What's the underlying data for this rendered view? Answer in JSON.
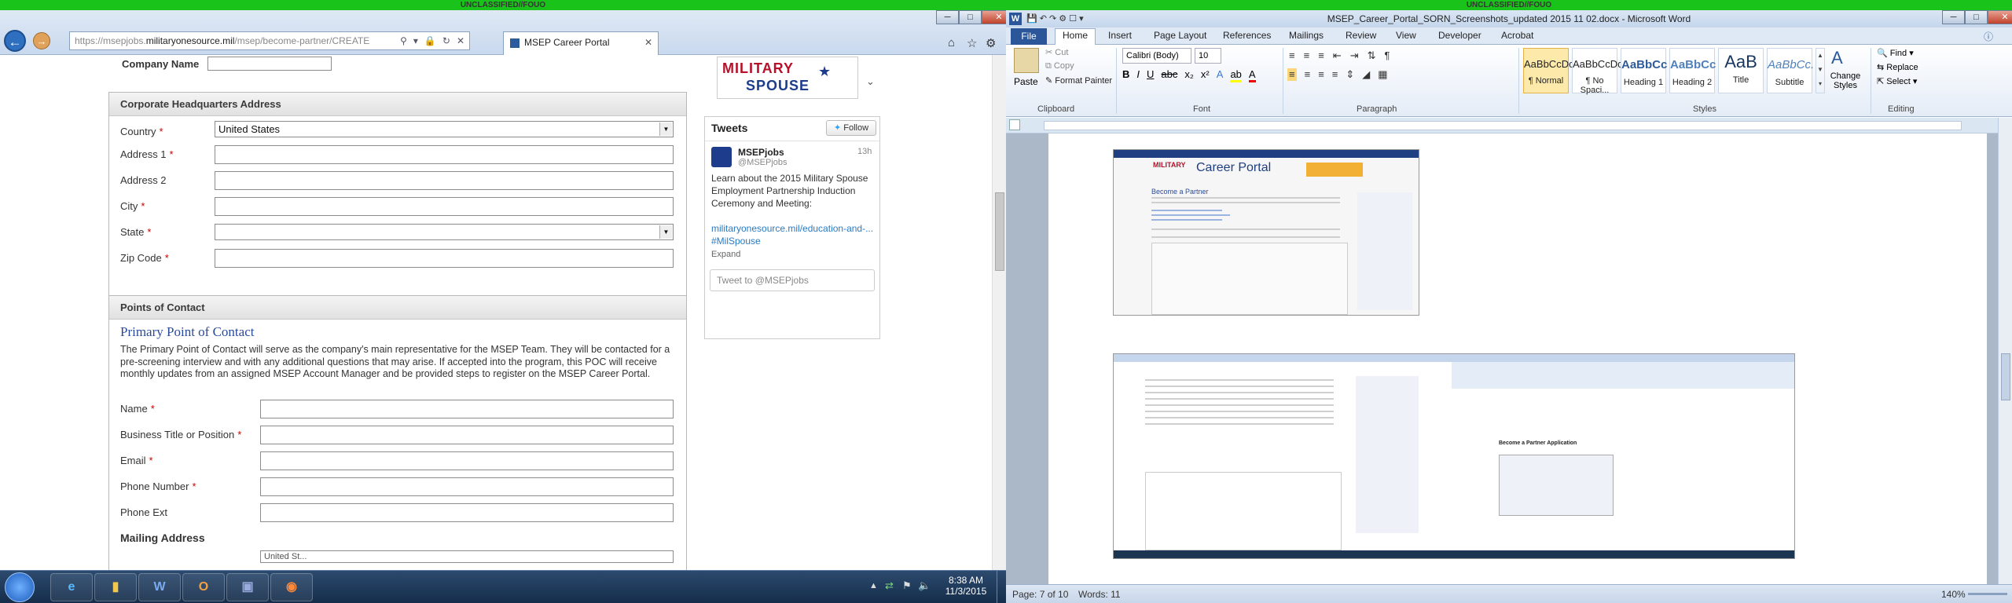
{
  "classification": {
    "left": "UNCLASSIFIED//FOUO",
    "right": "UNCLASSIFIED//FOUO"
  },
  "browser": {
    "url_prefix": "https://msepjobs.",
    "url_domain": "militaryonesource.mil",
    "url_path": "/msep/become-partner/CREATE",
    "tab_title": "MSEP Career Portal",
    "window_buttons": [
      "─",
      "□",
      "✕"
    ]
  },
  "form": {
    "company_name_label": "Company Name",
    "hq": {
      "title": "Corporate Headquarters Address",
      "country_label": "Country",
      "country_value": "United States",
      "address1_label": "Address 1",
      "address2_label": "Address 2",
      "city_label": "City",
      "state_label": "State",
      "zip_label": "Zip Code"
    },
    "poc": {
      "title": "Points of Contact",
      "primary_heading": "Primary Point of Contact",
      "primary_desc": "The Primary Point of Contact will serve as the company's main representative for the MSEP Team. They will be contacted for a pre-screening interview and with any additional questions that may arise.  If accepted into the program, this POC will receive monthly updates from an assigned MSEP Account Manager and be provided steps to register on the MSEP Career Portal.",
      "name_label": "Name",
      "title_label": "Business Title or Position",
      "email_label": "Email",
      "phone_label": "Phone Number",
      "ext_label": "Phone Ext",
      "mailing_heading": "Mailing Address",
      "mailing_value": "United St..."
    }
  },
  "sidebar": {
    "banner_line1": "MILITARY",
    "banner_line2": "SPOUSE",
    "tweets_title": "Tweets",
    "follow_label": "Follow",
    "tweet_user": "MSEPjobs",
    "tweet_handle": "@MSEPjobs",
    "tweet_time": "13h",
    "tweet_text": "Learn about the 2015 Military Spouse Employment Partnership Induction Ceremony and Meeting:",
    "tweet_link": "militaryonesource.mil/education-and-... #MilSpouse",
    "expand_label": "Expand",
    "tweet_placeholder": "Tweet to @MSEPjobs"
  },
  "taskbar": {
    "time": "8:38 AM",
    "date": "11/3/2015"
  },
  "word": {
    "title": "MSEP_Career_Portal_SORN_Screenshots_updated 2015 11 02.docx - Microsoft Word",
    "file_tab": "File",
    "tabs": [
      "Home",
      "Insert",
      "Page Layout",
      "References",
      "Mailings",
      "Review",
      "View",
      "Developer",
      "Acrobat"
    ],
    "clipboard": {
      "paste": "Paste",
      "cut": "Cut",
      "copy": "Copy",
      "format_painter": "Format Painter",
      "label": "Clipboard"
    },
    "font": {
      "name": "Calibri (Body)",
      "size": "10",
      "label": "Font"
    },
    "paragraph_label": "Paragraph",
    "styles": [
      {
        "sample": "AaBbCcDc",
        "name": "¶ Normal"
      },
      {
        "sample": "AaBbCcDc",
        "name": "¶ No Spaci..."
      },
      {
        "sample": "AaBbCc",
        "name": "Heading 1"
      },
      {
        "sample": "AaBbCc",
        "name": "Heading 2"
      },
      {
        "sample": "AaB",
        "name": "Title"
      },
      {
        "sample": "AaBbCc.",
        "name": "Subtitle"
      }
    ],
    "styles_label": "Styles",
    "change_styles": "Change Styles",
    "editing": {
      "find": "Find",
      "replace": "Replace",
      "select": "Select",
      "label": "Editing"
    },
    "status": {
      "page": "Page: 7 of 10",
      "words": "Words: 11",
      "zoom": "140%"
    },
    "doc_caption": "Become a Partner Application",
    "portal_title": "Career Portal",
    "portal_heading": "Become a Partner"
  }
}
